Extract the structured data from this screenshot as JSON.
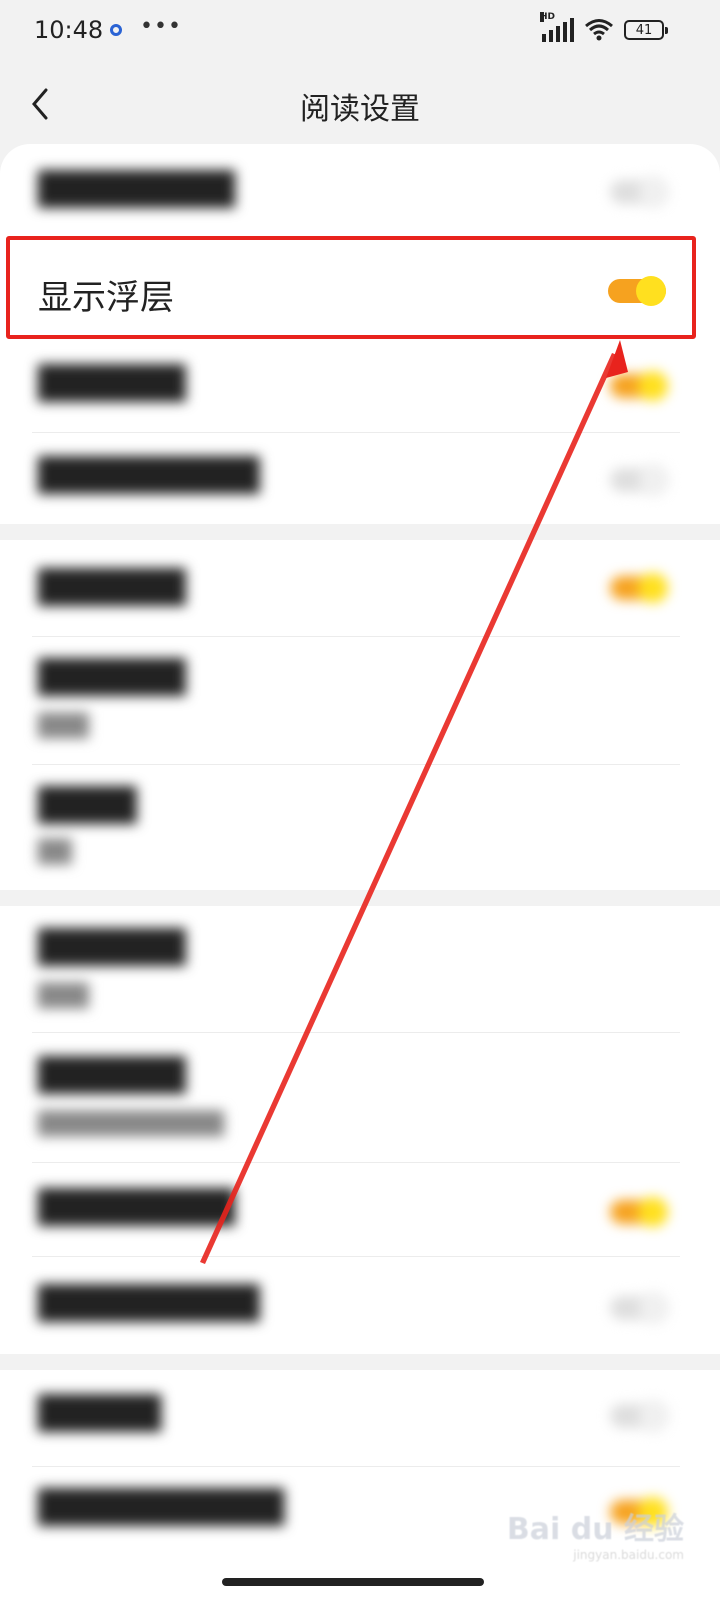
{
  "status": {
    "time": "10:48",
    "battery": "41",
    "network_badge": "HD"
  },
  "header": {
    "title": "阅读设置",
    "back_icon": "chevron-left-icon"
  },
  "highlighted_setting": {
    "label": "显示浮层",
    "enabled": true
  },
  "colors": {
    "accent": "#f6a21f",
    "knob": "#ffe01f",
    "highlight_border": "#e8231d"
  },
  "watermark": {
    "logo": "Bai du 经验",
    "url": "jingyan.baidu.com"
  }
}
